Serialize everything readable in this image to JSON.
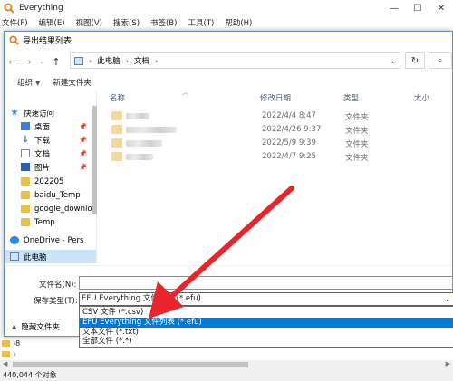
{
  "app": {
    "title": "Everything",
    "menu": [
      "文件(F)",
      "编辑(E)",
      "视图(V)",
      "搜索(S)",
      "书签(B)",
      "工具(T)",
      "帮助(H)"
    ],
    "bg_rows": [
      ")8",
      ")"
    ],
    "status": "440,044 个对象"
  },
  "dialog": {
    "title": "导出结果列表",
    "address": {
      "segments": [
        "此电脑",
        "文档"
      ]
    },
    "toolbar": {
      "organize": "组织",
      "new_folder": "新建文件夹"
    },
    "sidebar": [
      {
        "label": "快速访问",
        "icon": "star-icon"
      },
      {
        "label": "桌面",
        "icon": "desktop-icon",
        "pinned": true
      },
      {
        "label": "下载",
        "icon": "download-icon",
        "pinned": true
      },
      {
        "label": "文档",
        "icon": "documents-icon",
        "pinned": true
      },
      {
        "label": "图片",
        "icon": "pictures-icon",
        "pinned": true
      },
      {
        "label": "202205",
        "icon": "folder-icon"
      },
      {
        "label": "baidu_Temp",
        "icon": "folder-icon"
      },
      {
        "label": "google_downlo",
        "icon": "folder-icon"
      },
      {
        "label": "Temp",
        "icon": "folder-icon"
      },
      {
        "label": "OneDrive - Pers",
        "icon": "onedrive-icon"
      },
      {
        "label": "此电脑",
        "icon": "pc-icon",
        "selected": true
      }
    ],
    "columns": {
      "name": "名称",
      "date": "修改日期",
      "type": "类型",
      "size": "大小"
    },
    "files": [
      {
        "date": "2022/4/4 8:47",
        "type": "文件夹"
      },
      {
        "date": "2022/4/26 9:37",
        "type": "文件夹"
      },
      {
        "date": "2022/5/9 9:39",
        "type": "文件夹"
      },
      {
        "date": "2022/4/7 9:25",
        "type": "文件夹"
      }
    ],
    "form": {
      "filename_label": "文件名(N):",
      "filename_value": "",
      "savetype_label": "保存类型(T):",
      "savetype_value": "EFU Everything 文件列表 (*.efu)",
      "hide_folders": "隐藏文件夹",
      "options": [
        "CSV 文件 (*.csv)",
        "EFU Everything 文件列表 (*.efu)",
        "文本文件 (*.txt)",
        "全部文件 (*.*)"
      ],
      "highlighted_index": 1
    }
  },
  "colors": {
    "accent": "#0078d7",
    "annotation": "#e8242c",
    "folder": "#e8c14a"
  }
}
